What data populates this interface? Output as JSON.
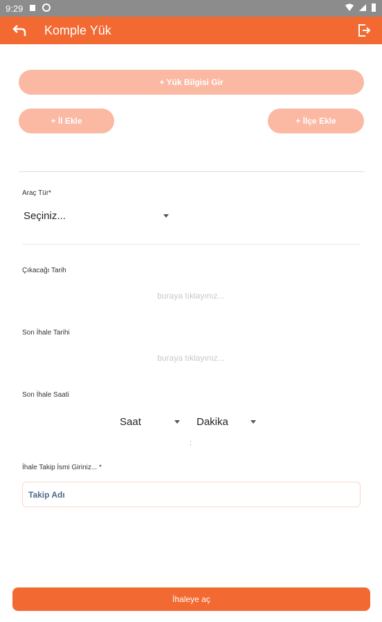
{
  "status": {
    "time": "9:29"
  },
  "toolbar": {
    "title": "Komple Yük"
  },
  "buttons": {
    "add_cargo": "+ Yük Bilgisi Gir",
    "add_city": "+ İl Ekle",
    "add_district": "+ İlçe Ekle",
    "submit": "İhaleye aç"
  },
  "form": {
    "vehicle_type_label": "Araç Tür*",
    "vehicle_type_value": "Seçiniz...",
    "departure_date_label": "Çıkacağı Tarih",
    "departure_date_placeholder": "buraya tıklayınız...",
    "last_bid_date_label": "Son İhale Tarihi",
    "last_bid_date_placeholder": "buraya tıklayınız...",
    "last_bid_time_label": "Son İhale Saati",
    "hour_value": "Saat",
    "minute_value": "Dakika",
    "time_separator": ":",
    "tracking_name_label": "İhale Takip İsmi Giriniz... *",
    "tracking_name_placeholder": "Takip Adı"
  },
  "colors": {
    "accent": "#f26a32",
    "pill": "#fbb8a3"
  }
}
